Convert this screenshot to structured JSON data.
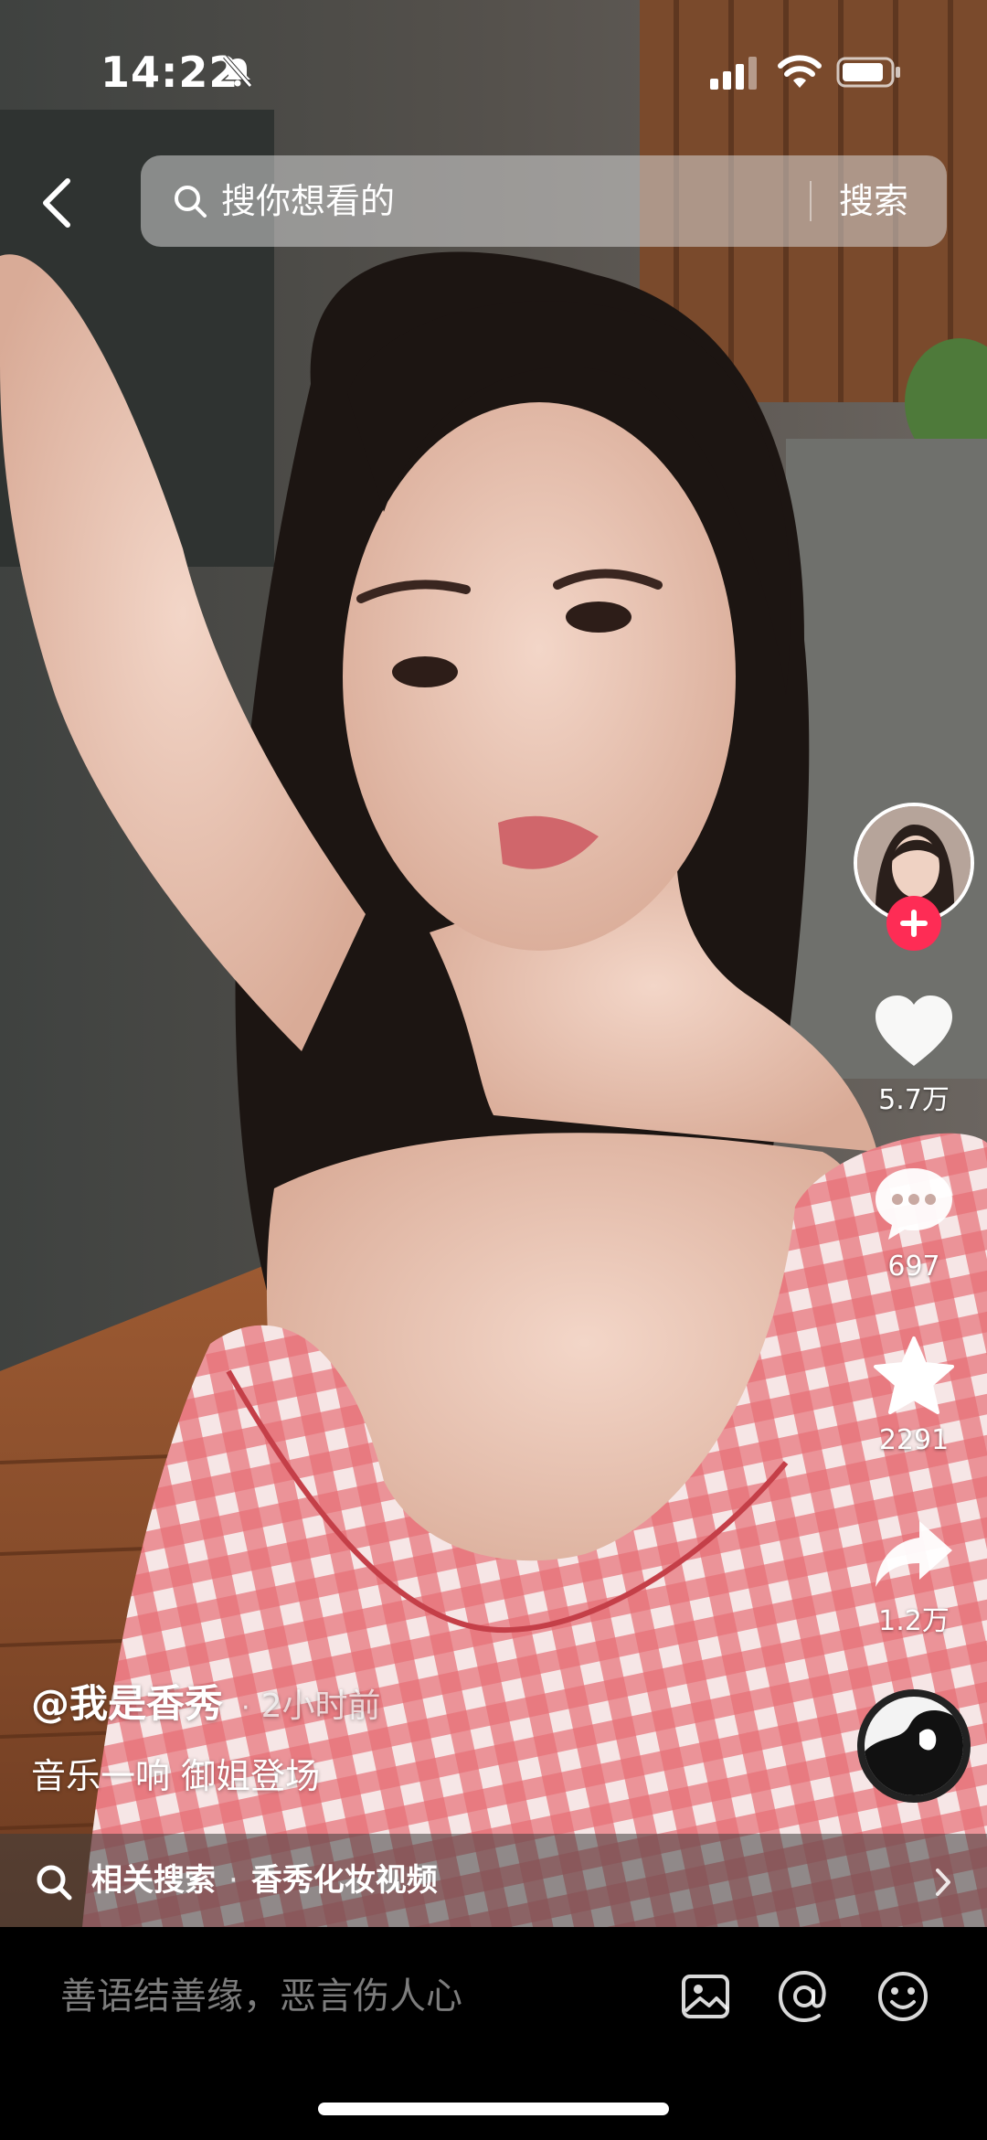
{
  "status_bar": {
    "time": "14:22"
  },
  "header": {
    "search_placeholder": "搜你想看的",
    "search_button": "搜索"
  },
  "actions": {
    "likes": "5.7万",
    "comments": "697",
    "favorites": "2291",
    "shares": "1.2万"
  },
  "caption": {
    "author": "@我是香秀",
    "separator": "·",
    "posted": "2小时前",
    "description": "音乐一响 御姐登场"
  },
  "related": {
    "prefix": "相关搜索",
    "separator": "·",
    "query": "香秀化妆视频"
  },
  "comment_bar": {
    "placeholder": "善语结善缘，恶言伤人心"
  },
  "colors": {
    "follow_accent": "#fe2c55",
    "background": "#000000"
  }
}
